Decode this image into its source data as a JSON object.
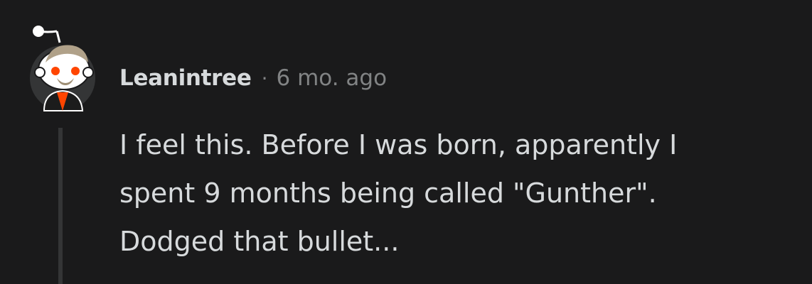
{
  "comment": {
    "author": "Leanintree",
    "separator": "·",
    "timestamp": "6 mo. ago",
    "body_lines": [
      "I feel this. Before I was born, apparently I",
      "spent 9 months being called \"Gunther\".",
      "Dodged that bullet..."
    ],
    "avatar_icon": "snoo-avatar-icon"
  },
  "colors": {
    "background": "#1a1a1b",
    "text_primary": "#d7dadc",
    "text_meta": "#818384",
    "thread_line": "#343536",
    "avatar_shirt": "#ff4500"
  }
}
